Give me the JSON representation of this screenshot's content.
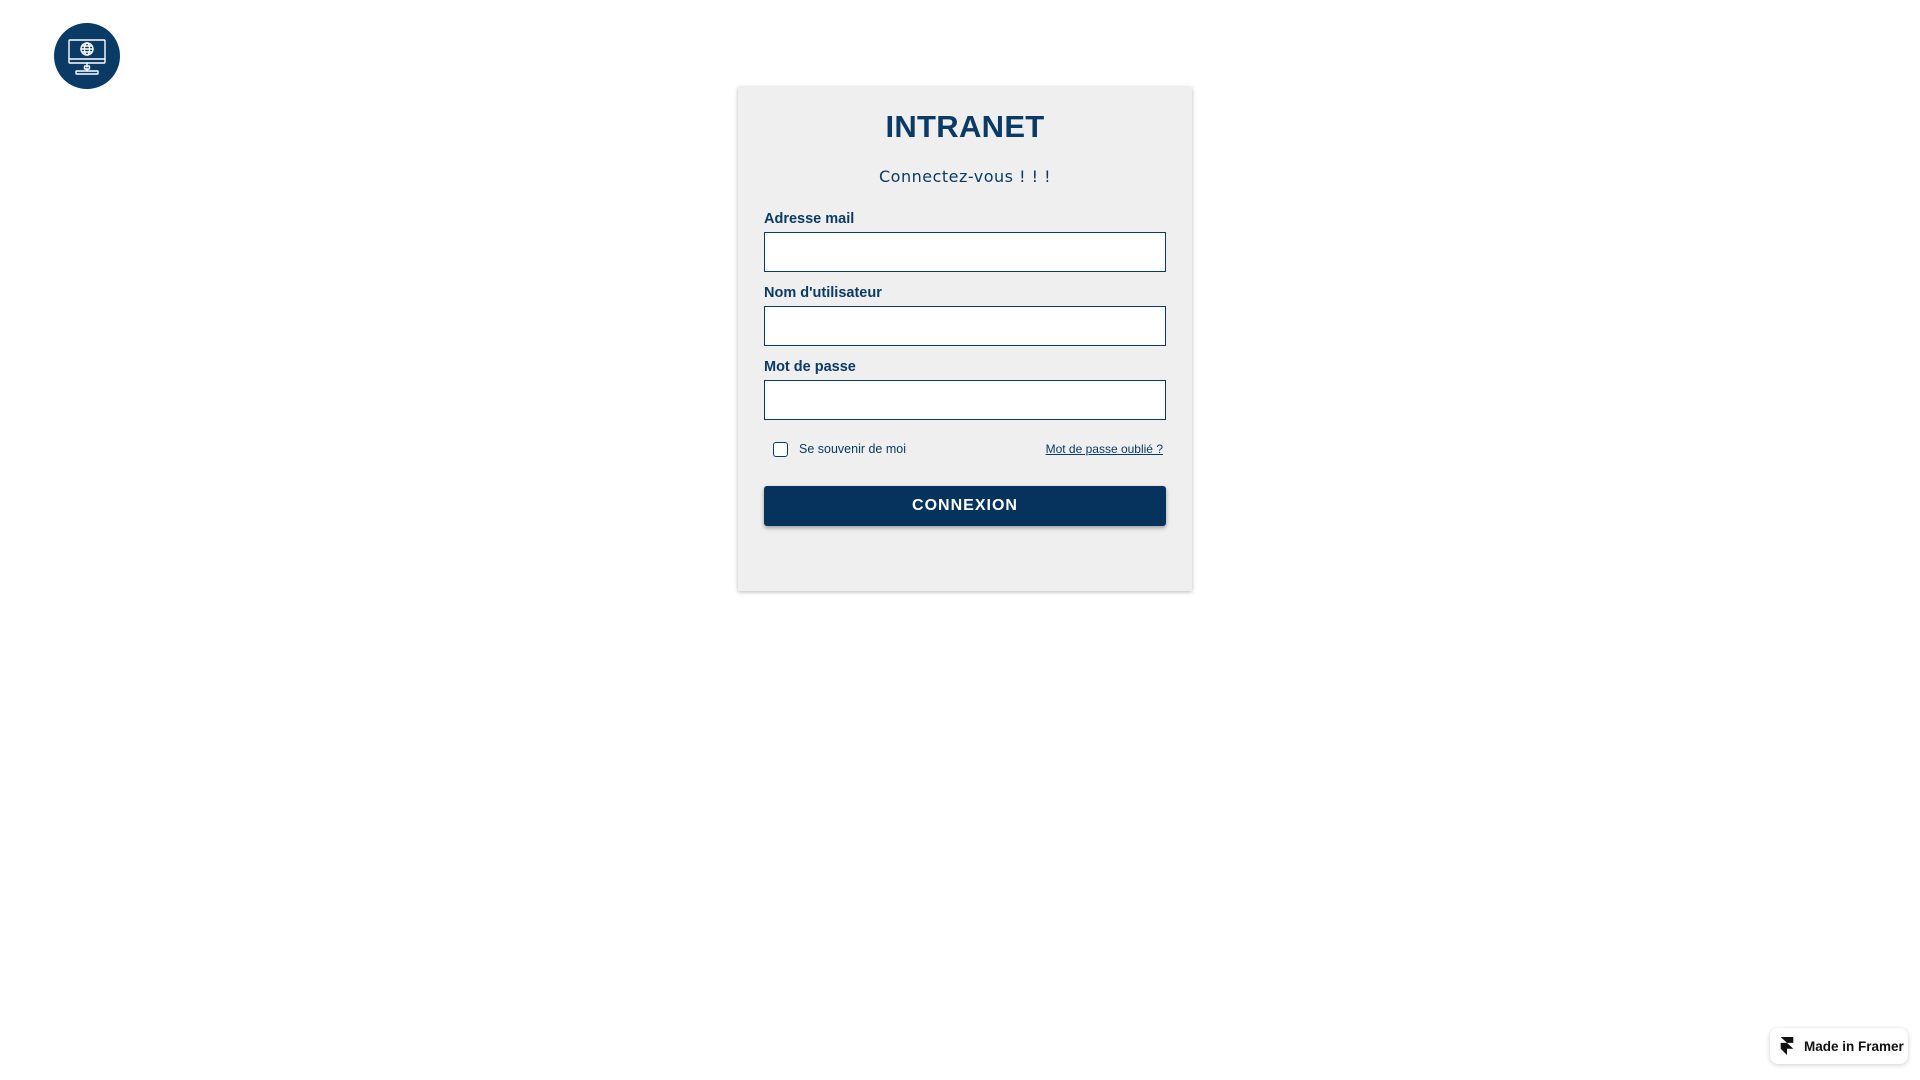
{
  "logo": {
    "icon": "computer-globe-icon",
    "background_color": "#0a3a66"
  },
  "login_card": {
    "title": "INTRANET",
    "subtitle": "Connectez-vous ! ! !",
    "fields": [
      {
        "label": "Adresse mail",
        "value": "",
        "placeholder": ""
      },
      {
        "label": "Nom d'utilisateur",
        "value": "",
        "placeholder": ""
      },
      {
        "label": "Mot de passe",
        "value": "",
        "placeholder": ""
      }
    ],
    "remember_me": {
      "label": "Se souvenir de moi",
      "checked": false
    },
    "forgot_password_label": "Mot de passe oublié ?",
    "submit_label": "CONNEXION"
  },
  "framer_badge": {
    "icon": "framer-icon",
    "label": "Made in Framer"
  },
  "colors": {
    "primary": "#0a3a66",
    "card_background": "#efefef",
    "page_background": "#ffffff"
  }
}
